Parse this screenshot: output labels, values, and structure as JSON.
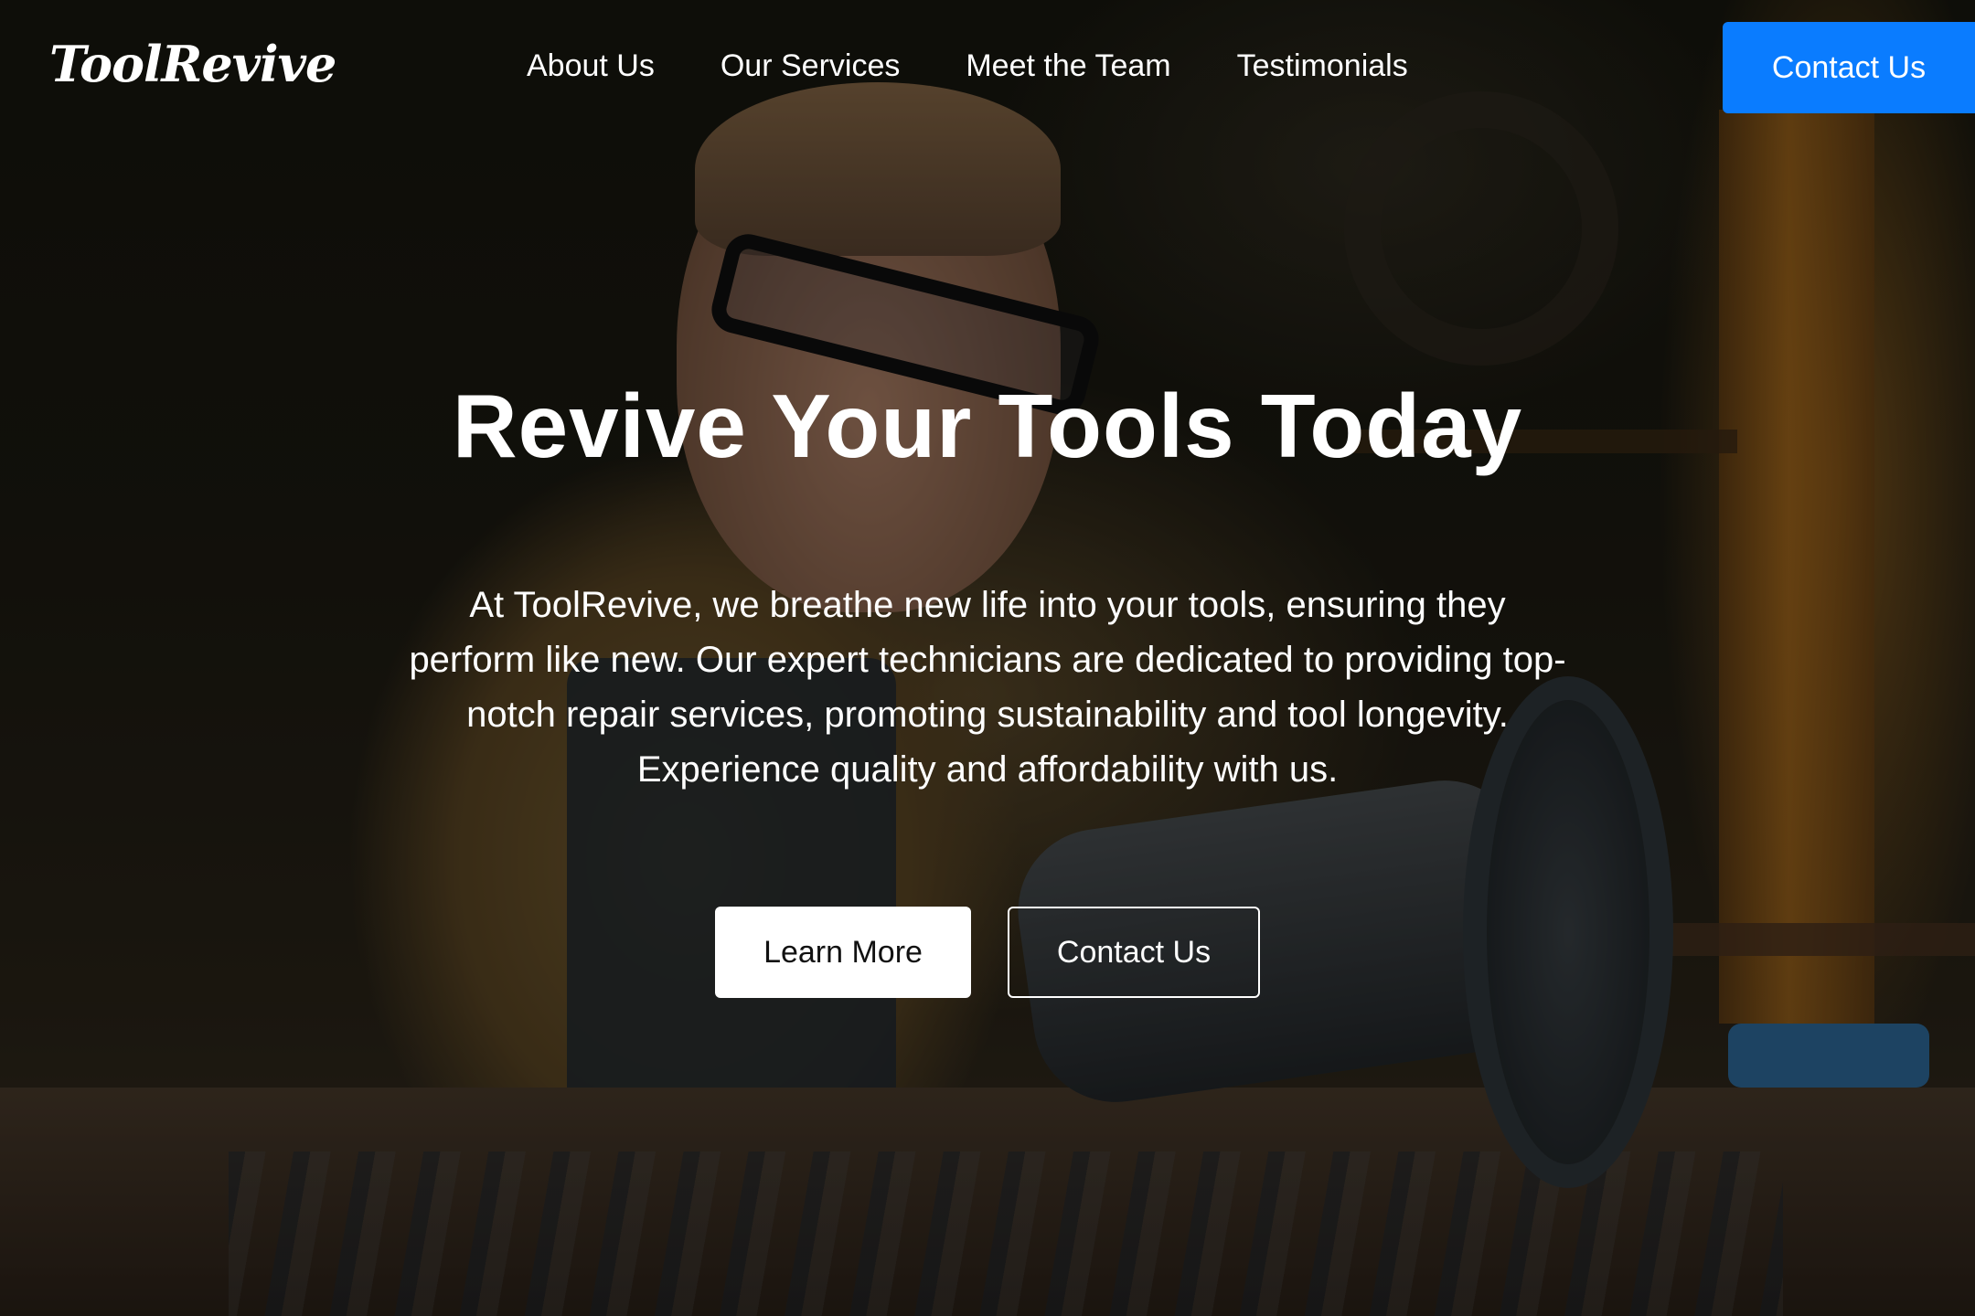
{
  "brand": {
    "logo_text": "ToolRevive"
  },
  "nav": {
    "links": [
      "About Us",
      "Our Services",
      "Meet the Team",
      "Testimonials"
    ],
    "cta_label": "Contact Us"
  },
  "hero": {
    "title": "Revive Your Tools Today",
    "description": "At ToolRevive, we breathe new life into your tools, ensuring they perform like new. Our expert technicians are dedicated to providing top-notch repair services, promoting sustainability and tool longevity. Experience quality and affordability with us.",
    "primary_button": "Learn More",
    "secondary_button": "Contact Us",
    "background_image": "craftsman-repairing-power-tool-photo"
  },
  "colors": {
    "accent": "#0a7cff",
    "text": "#ffffff",
    "primary_button_bg": "#ffffff",
    "primary_button_text": "#111111"
  }
}
